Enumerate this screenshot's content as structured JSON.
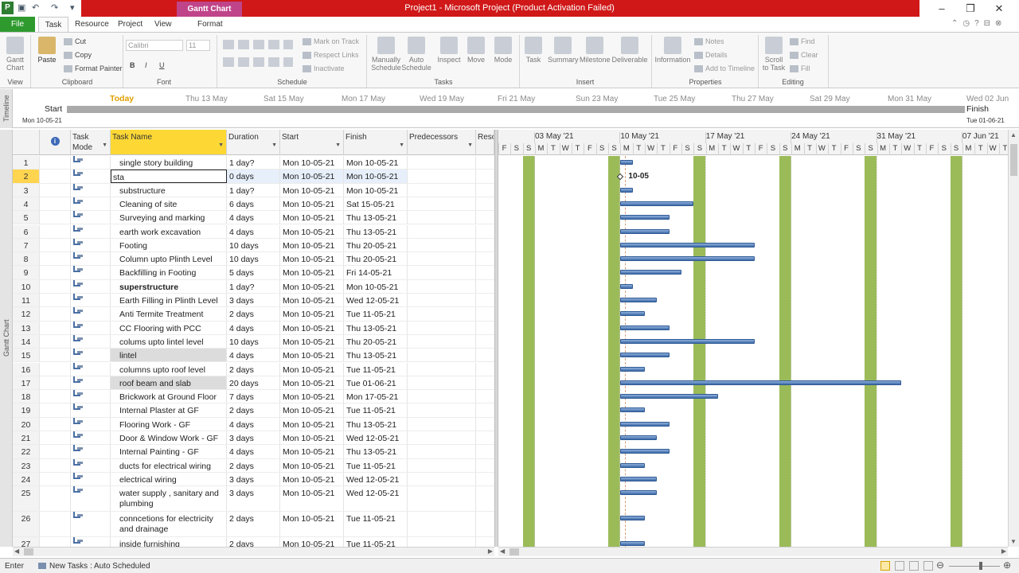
{
  "window": {
    "title": "Project1  -  Microsoft Project (Product Activation Failed)",
    "context_tab": "Gantt Chart Tools",
    "accent_red": "#d01818",
    "accent_green": "#2e9a2e"
  },
  "tabs": [
    "File",
    "Task",
    "Resource",
    "Project",
    "View",
    "Format"
  ],
  "ribbon": {
    "view": {
      "gantt": "Gantt\nChart",
      "label": "View"
    },
    "clipboard": {
      "paste": "Paste",
      "cut": "Cut",
      "copy": "Copy",
      "format_painter": "Format Painter",
      "label": "Clipboard"
    },
    "font": {
      "name": "Calibri",
      "size": "11",
      "bold": "B",
      "italic": "I",
      "underline": "U",
      "label": "Font"
    },
    "schedule": {
      "mark_on_track": "Mark on Track",
      "respect_links": "Respect Links",
      "inactivate": "Inactivate",
      "label": "Schedule"
    },
    "tasks": {
      "manual": "Manually\nSchedule",
      "auto": "Auto\nSchedule",
      "inspect": "Inspect",
      "move": "Move",
      "mode": "Mode",
      "label": "Tasks"
    },
    "insert": {
      "task": "Task",
      "summary": "Summary",
      "milestone": "Milestone",
      "deliverable": "Deliverable",
      "label": "Insert"
    },
    "properties": {
      "information": "Information",
      "notes": "Notes",
      "details": "Details",
      "add_timeline": "Add to Timeline",
      "label": "Properties"
    },
    "editing": {
      "scroll": "Scroll\nto Task",
      "find": "Find",
      "clear": "Clear",
      "fill": "Fill",
      "label": "Editing"
    }
  },
  "timeline": {
    "side_label": "Timeline",
    "start_label": "Start",
    "start_date": "Mon 10-05-21",
    "finish_label": "Finish",
    "finish_date": "Tue 01-06-21",
    "finish_day": "Wed 02 Jun",
    "today": "Today",
    "dates": [
      "Thu 13 May",
      "Sat 15 May",
      "Mon 17 May",
      "Wed 19 May",
      "Fri 21 May",
      "Sun 23 May",
      "Tue 25 May",
      "Thu 27 May",
      "Sat 29 May",
      "Mon 31 May"
    ]
  },
  "grid": {
    "side_label": "Gantt Chart",
    "headers": {
      "mode": "Task\nMode",
      "name": "Task Name",
      "duration": "Duration",
      "start": "Start",
      "finish": "Finish",
      "pred": "Predecessors",
      "res": "Reso"
    },
    "edit_value": "sta",
    "rows": [
      {
        "id": "1",
        "name": "single story building",
        "dur": "1 day?",
        "start": "Mon 10-05-21",
        "finish": "Mon 10-05-21",
        "bar_days": 1
      },
      {
        "id": "2",
        "name": "",
        "dur": "0 days",
        "start": "Mon 10-05-21",
        "finish": "Mon 10-05-21",
        "milestone_label": "10-05"
      },
      {
        "id": "3",
        "name": "substructure",
        "dur": "1 day?",
        "start": "Mon 10-05-21",
        "finish": "Mon 10-05-21",
        "bar_days": 1
      },
      {
        "id": "4",
        "name": "Cleaning of site",
        "dur": "6 days",
        "start": "Mon 10-05-21",
        "finish": "Sat 15-05-21",
        "bar_days": 6
      },
      {
        "id": "5",
        "name": "Surveying and marking",
        "dur": "4 days",
        "start": "Mon 10-05-21",
        "finish": "Thu 13-05-21",
        "bar_days": 4
      },
      {
        "id": "6",
        "name": "earth work excavation",
        "dur": "4 days",
        "start": "Mon 10-05-21",
        "finish": "Thu 13-05-21",
        "bar_days": 4
      },
      {
        "id": "7",
        "name": "Footing",
        "dur": "10 days",
        "start": "Mon 10-05-21",
        "finish": "Thu 20-05-21",
        "bar_days": 11
      },
      {
        "id": "8",
        "name": "Column upto Plinth Level",
        "dur": "10 days",
        "start": "Mon 10-05-21",
        "finish": "Thu 20-05-21",
        "bar_days": 11
      },
      {
        "id": "9",
        "name": "Backfilling in Footing",
        "dur": "5 days",
        "start": "Mon 10-05-21",
        "finish": "Fri 14-05-21",
        "bar_days": 5
      },
      {
        "id": "10",
        "name": "superstructure",
        "dur": "1 day?",
        "start": "Mon 10-05-21",
        "finish": "Mon 10-05-21",
        "bar_days": 1,
        "bold": true
      },
      {
        "id": "11",
        "name": "Earth Filling in Plinth Level",
        "dur": "3 days",
        "start": "Mon 10-05-21",
        "finish": "Wed 12-05-21",
        "bar_days": 3
      },
      {
        "id": "12",
        "name": "Anti Termite Treatment",
        "dur": "2 days",
        "start": "Mon 10-05-21",
        "finish": "Tue 11-05-21",
        "bar_days": 2
      },
      {
        "id": "13",
        "name": "CC Flooring with PCC",
        "dur": "4 days",
        "start": "Mon 10-05-21",
        "finish": "Thu 13-05-21",
        "bar_days": 4
      },
      {
        "id": "14",
        "name": "colums upto lintel level",
        "dur": "10 days",
        "start": "Mon 10-05-21",
        "finish": "Thu 20-05-21",
        "bar_days": 11
      },
      {
        "id": "15",
        "name": "lintel",
        "dur": "4 days",
        "start": "Mon 10-05-21",
        "finish": "Thu 13-05-21",
        "bar_days": 4,
        "hl": true
      },
      {
        "id": "16",
        "name": "columns upto roof level",
        "dur": "2 days",
        "start": "Mon 10-05-21",
        "finish": "Tue 11-05-21",
        "bar_days": 2
      },
      {
        "id": "17",
        "name": "roof beam and slab",
        "dur": "20 days",
        "start": "Mon 10-05-21",
        "finish": "Tue 01-06-21",
        "bar_days": 23,
        "hl": true
      },
      {
        "id": "18",
        "name": "Brickwork at Ground Floor",
        "dur": "7 days",
        "start": "Mon 10-05-21",
        "finish": "Mon 17-05-21",
        "bar_days": 8
      },
      {
        "id": "19",
        "name": "Internal Plaster at GF",
        "dur": "2 days",
        "start": "Mon 10-05-21",
        "finish": "Tue 11-05-21",
        "bar_days": 2
      },
      {
        "id": "20",
        "name": "Flooring Work - GF",
        "dur": "4 days",
        "start": "Mon 10-05-21",
        "finish": "Thu 13-05-21",
        "bar_days": 4
      },
      {
        "id": "21",
        "name": "Door & Window Work - GF",
        "dur": "3 days",
        "start": "Mon 10-05-21",
        "finish": "Wed 12-05-21",
        "bar_days": 3
      },
      {
        "id": "22",
        "name": "Internal Painting - GF",
        "dur": "4 days",
        "start": "Mon 10-05-21",
        "finish": "Thu 13-05-21",
        "bar_days": 4
      },
      {
        "id": "23",
        "name": "ducts for electrical wiring",
        "dur": "2 days",
        "start": "Mon 10-05-21",
        "finish": "Tue 11-05-21",
        "bar_days": 2
      },
      {
        "id": "24",
        "name": "electrical wiring",
        "dur": "3 days",
        "start": "Mon 10-05-21",
        "finish": "Wed 12-05-21",
        "bar_days": 3
      },
      {
        "id": "25",
        "name": "water supply , sanitary and plumbing",
        "dur": "3 days",
        "start": "Mon 10-05-21",
        "finish": "Wed 12-05-21",
        "bar_days": 3,
        "tall": true
      },
      {
        "id": "26",
        "name": "conncetions for electricity and drainage",
        "dur": "2 days",
        "start": "Mon 10-05-21",
        "finish": "Tue 11-05-21",
        "bar_days": 2,
        "tall": true
      },
      {
        "id": "27",
        "name": "inside furnishing",
        "dur": "2 days",
        "start": "Mon 10-05-21",
        "finish": "Tue 11-05-21",
        "bar_days": 2
      }
    ]
  },
  "gantt": {
    "weeks": [
      "03 May '21",
      "10 May '21",
      "17 May '21",
      "24 May '21",
      "31 May '21",
      "07 Jun '21"
    ],
    "days": [
      "F",
      "S",
      "S",
      "M",
      "T",
      "W",
      "T",
      "F",
      "S",
      "S",
      "M",
      "T",
      "W",
      "T",
      "F",
      "S",
      "S",
      "M",
      "T",
      "W",
      "T",
      "F",
      "S",
      "S",
      "M",
      "T",
      "W",
      "T",
      "F",
      "S",
      "S",
      "M",
      "T",
      "W",
      "T",
      "F",
      "S",
      "S",
      "M",
      "T",
      "W",
      "T",
      "F",
      "S",
      "S",
      "M",
      "T",
      "W",
      "T"
    ],
    "weekend_color": "#9bbb59",
    "bar_color": "#4f81bd"
  },
  "status": {
    "mode": "Enter",
    "new_tasks": "New Tasks : Auto Scheduled"
  }
}
